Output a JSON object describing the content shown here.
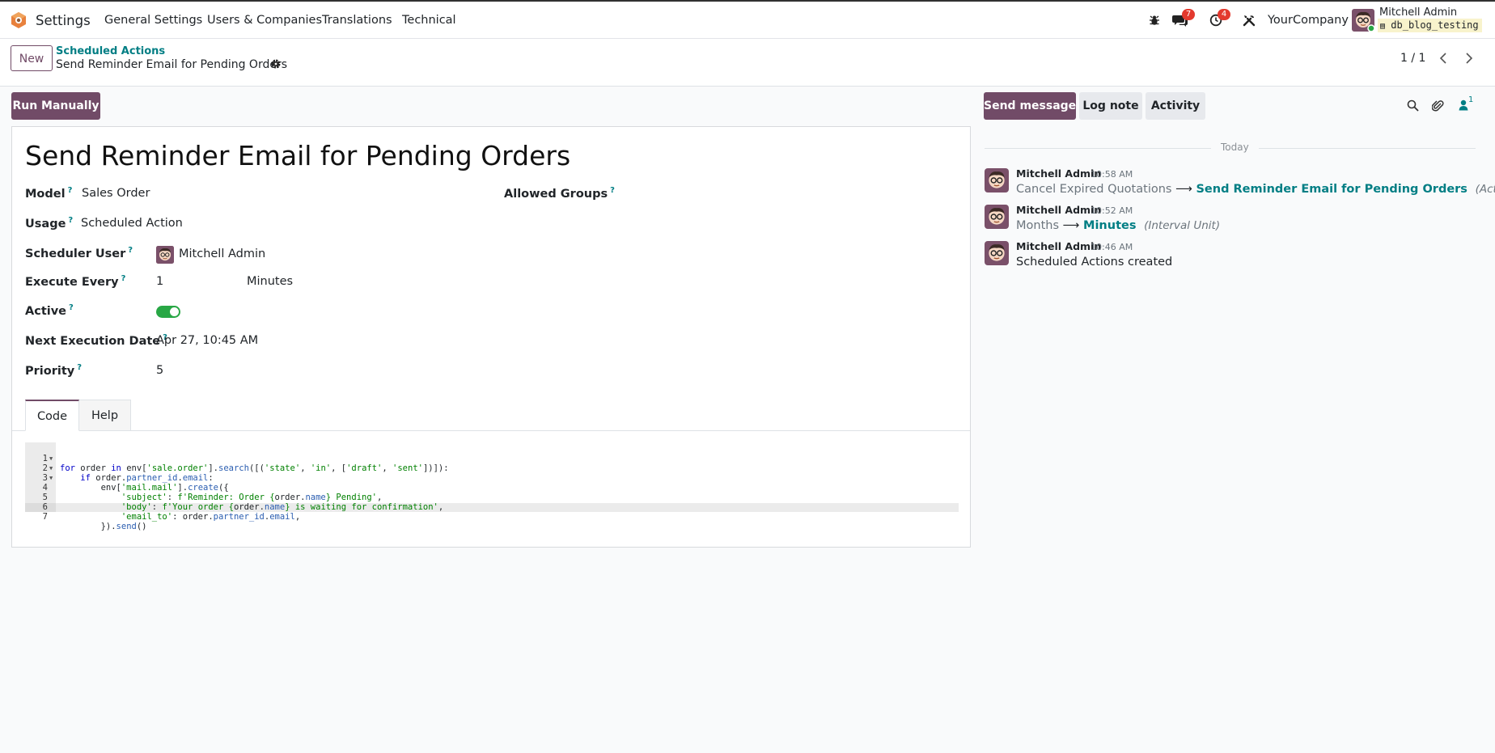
{
  "navbar": {
    "app_name": "Settings",
    "menus": [
      "General Settings",
      "Users & Companies",
      "Translations",
      "Technical"
    ],
    "messages_count": "7",
    "activities_count": "4",
    "company": "YourCompany",
    "user_name": "Mitchell Admin",
    "database": "db_blog_testing"
  },
  "control": {
    "new_label": "New",
    "breadcrumb": "Scheduled Actions",
    "record_name": "Send Reminder Email for Pending Orders",
    "pager": "1 / 1"
  },
  "buttons": {
    "run_manually": "Run Manually",
    "send_message": "Send message",
    "log_note": "Log note",
    "activity": "Activity",
    "followers_count": "1"
  },
  "form": {
    "title": "Send Reminder Email for Pending Orders",
    "fields": {
      "model": {
        "label": "Model",
        "value": "Sales Order"
      },
      "allowed_groups": {
        "label": "Allowed Groups"
      },
      "usage": {
        "label": "Usage",
        "value": "Scheduled Action"
      },
      "scheduler_user": {
        "label": "Scheduler User",
        "value": "Mitchell Admin"
      },
      "execute_every": {
        "label": "Execute Every",
        "value": "1",
        "unit": "Minutes"
      },
      "active": {
        "label": "Active",
        "value": true
      },
      "next_execution": {
        "label": "Next Execution Date",
        "value": "Apr 27, 10:45 AM"
      },
      "priority": {
        "label": "Priority",
        "value": "5"
      }
    },
    "tabs": [
      "Code",
      "Help"
    ],
    "code_lines": [
      "for order in env['sale.order'].search([('state', 'in', ['draft', 'sent'])]):",
      "    if order.partner_id.email:",
      "        env['mail.mail'].create({",
      "            'subject': f'Reminder: Order {order.name} Pending',",
      "            'body': f'Your order {order.name} is waiting for confirmation',",
      "            'email_to': order.partner_id.email,",
      "        }).send()"
    ]
  },
  "chatter": {
    "separator": "Today",
    "messages": [
      {
        "author": "Mitchell Admin",
        "time": "10:58 AM",
        "old": "Cancel Expired Quotations",
        "new": "Send Reminder Email for Pending Orders",
        "field": "(Action Name)"
      },
      {
        "author": "Mitchell Admin",
        "time": "10:52 AM",
        "old": "Months",
        "new": "Minutes",
        "field": "(Interval Unit)"
      },
      {
        "author": "Mitchell Admin",
        "time": "10:46 AM",
        "body": "Scheduled Actions created"
      }
    ]
  },
  "colors": {
    "brand": "#714b67",
    "link": "#017e84",
    "toggle_on": "#28a745",
    "badge": "#e3392e"
  }
}
